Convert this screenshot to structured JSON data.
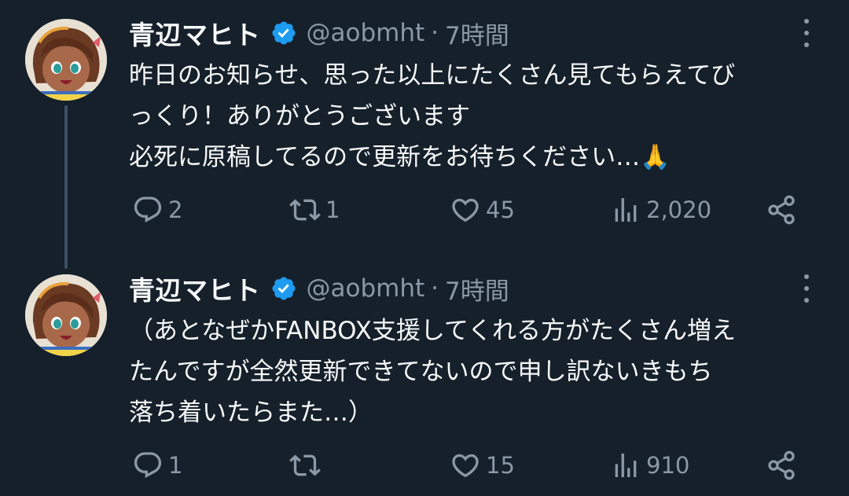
{
  "tweets": [
    {
      "display_name": "青辺マヒト",
      "handle": "@aobmht",
      "separator": "·",
      "time": "7時間",
      "lines": [
        "昨日のお知らせ、思った以上にたくさん見てもらえてび",
        "っくり！ありがとうございます",
        "必死に原稿してるので更新をお待ちください…🙏"
      ],
      "reply_count": "2",
      "retweet_count": "1",
      "like_count": "45",
      "view_count": "2,020"
    },
    {
      "display_name": "青辺マヒト",
      "handle": "@aobmht",
      "separator": "·",
      "time": "7時間",
      "lines": [
        "（あとなぜかFANBOX支援してくれる方がたくさん増え",
        "たんですが全然更新できてないので申し訳ないきもち",
        "落ち着いたらまた…）"
      ],
      "reply_count": "1",
      "retweet_count": "",
      "like_count": "15",
      "view_count": "910"
    }
  ],
  "icons": {
    "verified": "verified-badge-icon",
    "reply": "reply-bubble-icon",
    "retweet": "retweet-icon",
    "like": "heart-icon",
    "views": "views-bar-chart-icon",
    "share": "share-icon",
    "more": "more-vertical-icon"
  },
  "colors": {
    "background": "#15202b",
    "text_primary": "#f7f9f9",
    "text_secondary": "#8b98a5",
    "verified_blue": "#1d9bf0",
    "thread_line": "#3e5063"
  }
}
